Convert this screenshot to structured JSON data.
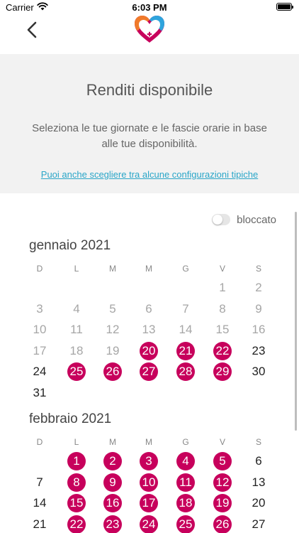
{
  "status_bar": {
    "carrier": "Carrier",
    "time": "6:03 PM"
  },
  "header": {
    "title": "Renditi disponibile",
    "description": "Seleziona le tue giornate e le fascie orarie in base alle tue disponibilità.",
    "link": "Puoi anche scegliere tra alcune configurazioni tipiche"
  },
  "toggle": {
    "label": "bloccato",
    "on": false
  },
  "colors": {
    "available": "#c7005c",
    "link": "#2aa6c8",
    "panel": "#f2f2f2"
  },
  "icons": {
    "back": "chevron-left-icon",
    "logo": "heart-plus-logo-icon",
    "wifi": "wifi-icon",
    "battery": "battery-icon"
  },
  "weekdays": [
    "D",
    "L",
    "M",
    "M",
    "G",
    "V",
    "S"
  ],
  "months": [
    {
      "title": "gennaio 2021",
      "weeks": [
        [
          null,
          null,
          null,
          null,
          null,
          {
            "d": "1",
            "s": "past"
          },
          {
            "d": "2",
            "s": "past"
          }
        ],
        [
          {
            "d": "3",
            "s": "past"
          },
          {
            "d": "4",
            "s": "past"
          },
          {
            "d": "5",
            "s": "past"
          },
          {
            "d": "6",
            "s": "past"
          },
          {
            "d": "7",
            "s": "past"
          },
          {
            "d": "8",
            "s": "past"
          },
          {
            "d": "9",
            "s": "past"
          }
        ],
        [
          {
            "d": "10",
            "s": "past"
          },
          {
            "d": "11",
            "s": "past"
          },
          {
            "d": "12",
            "s": "past"
          },
          {
            "d": "13",
            "s": "past"
          },
          {
            "d": "14",
            "s": "past"
          },
          {
            "d": "15",
            "s": "past"
          },
          {
            "d": "16",
            "s": "past"
          }
        ],
        [
          {
            "d": "17",
            "s": "past"
          },
          {
            "d": "18",
            "s": "past"
          },
          {
            "d": "19",
            "s": "past"
          },
          {
            "d": "20",
            "s": "available"
          },
          {
            "d": "21",
            "s": "available"
          },
          {
            "d": "22",
            "s": "available"
          },
          {
            "d": "23",
            "s": "future"
          }
        ],
        [
          {
            "d": "24",
            "s": "future"
          },
          {
            "d": "25",
            "s": "available"
          },
          {
            "d": "26",
            "s": "available"
          },
          {
            "d": "27",
            "s": "available"
          },
          {
            "d": "28",
            "s": "available"
          },
          {
            "d": "29",
            "s": "available"
          },
          {
            "d": "30",
            "s": "future"
          }
        ],
        [
          {
            "d": "31",
            "s": "future"
          },
          null,
          null,
          null,
          null,
          null,
          null
        ]
      ]
    },
    {
      "title": "febbraio 2021",
      "weeks": [
        [
          null,
          {
            "d": "1",
            "s": "available"
          },
          {
            "d": "2",
            "s": "available"
          },
          {
            "d": "3",
            "s": "available"
          },
          {
            "d": "4",
            "s": "available"
          },
          {
            "d": "5",
            "s": "available"
          },
          {
            "d": "6",
            "s": "future"
          }
        ],
        [
          {
            "d": "7",
            "s": "future"
          },
          {
            "d": "8",
            "s": "available"
          },
          {
            "d": "9",
            "s": "available"
          },
          {
            "d": "10",
            "s": "available"
          },
          {
            "d": "11",
            "s": "available"
          },
          {
            "d": "12",
            "s": "available"
          },
          {
            "d": "13",
            "s": "future"
          }
        ],
        [
          {
            "d": "14",
            "s": "future"
          },
          {
            "d": "15",
            "s": "available"
          },
          {
            "d": "16",
            "s": "available"
          },
          {
            "d": "17",
            "s": "available"
          },
          {
            "d": "18",
            "s": "available"
          },
          {
            "d": "19",
            "s": "available"
          },
          {
            "d": "20",
            "s": "future"
          }
        ],
        [
          {
            "d": "21",
            "s": "future"
          },
          {
            "d": "22",
            "s": "available"
          },
          {
            "d": "23",
            "s": "available"
          },
          {
            "d": "24",
            "s": "available"
          },
          {
            "d": "25",
            "s": "available"
          },
          {
            "d": "26",
            "s": "available"
          },
          {
            "d": "27",
            "s": "future"
          }
        ]
      ]
    }
  ]
}
